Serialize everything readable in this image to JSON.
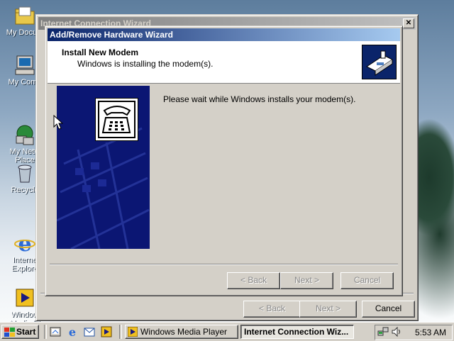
{
  "desktop": {
    "icons": [
      {
        "name": "my-documents",
        "label": "My Docum",
        "icon": "folder-icon"
      },
      {
        "name": "my-computer",
        "label": "My Comp",
        "icon": "computer-icon"
      },
      {
        "name": "my-network-places",
        "label": "My Netw\nPlace",
        "icon": "network-icon"
      },
      {
        "name": "recycle-bin",
        "label": "Recycle",
        "icon": "recycle-bin-icon"
      },
      {
        "name": "internet-explorer",
        "label": "Interne\nExplore",
        "icon": "ie-icon"
      },
      {
        "name": "windows-media-player",
        "label": "Window\nMedia Pl",
        "icon": "media-player-icon"
      }
    ]
  },
  "back_window": {
    "title": "Internet Connection Wizard",
    "close_glyph": "✕",
    "buttons": {
      "back": "< Back",
      "next": "Next >",
      "cancel": "Cancel"
    }
  },
  "wizard": {
    "title": "Add/Remove Hardware Wizard",
    "header_title": "Install New Modem",
    "header_subtitle": "Windows is installing the modem(s).",
    "message": "Please wait while Windows installs your modem(s).",
    "buttons": {
      "back": "< Back",
      "next": "Next >",
      "cancel": "Cancel"
    }
  },
  "taskbar": {
    "start_label": "Start",
    "quick_launch": [
      "show-desktop-icon",
      "ie-icon",
      "outlook-icon",
      "media-player-icon"
    ],
    "tasks": [
      {
        "label": "Windows Media Player",
        "active": false
      },
      {
        "label": "Internet Connection Wiz...",
        "active": true
      }
    ],
    "tray": {
      "icons": [
        "network-icon",
        "volume-icon"
      ],
      "clock": "5:53 AM"
    }
  },
  "colors": {
    "title_active": "#0a246a",
    "title_inactive": "#808080",
    "face": "#d4d0c8",
    "wizard_panel": "#0b1673"
  }
}
